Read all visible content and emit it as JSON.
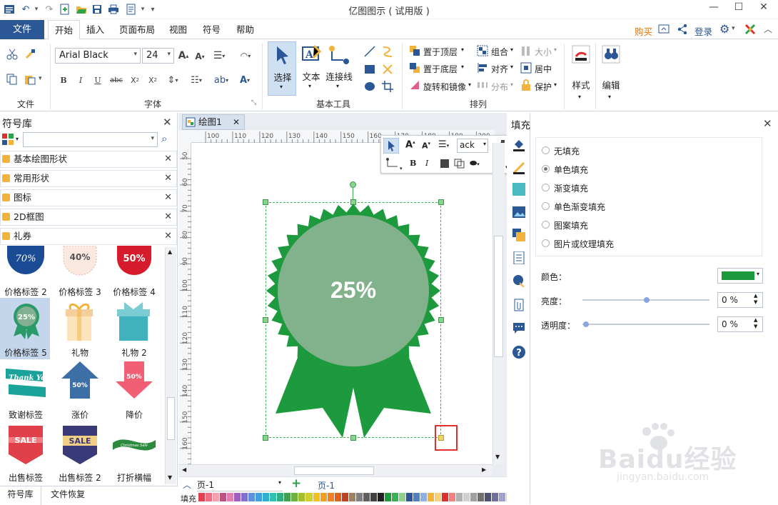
{
  "app": {
    "title": "亿图图示 ( 试用版 )",
    "buy": "购买",
    "login": "登录"
  },
  "menu": {
    "file": "文件",
    "items": [
      "开始",
      "插入",
      "页面布局",
      "视图",
      "符号",
      "帮助"
    ]
  },
  "ribbon": {
    "font_name": "Arial Black",
    "font_size": "24",
    "groups": [
      "文件",
      "字体",
      "基本工具",
      "排列"
    ],
    "tools": {
      "select": "选择",
      "text": "文本",
      "connector": "连接线"
    },
    "arrange": {
      "bring_front": "置于顶层",
      "send_back": "置于底层",
      "rotate": "旋转和镜像",
      "group": "组合",
      "align": "对齐",
      "distribute": "分布",
      "size": "大小",
      "center": "居中",
      "protect": "保护"
    },
    "style": "样式",
    "edit": "编辑"
  },
  "library": {
    "title": "符号库",
    "search_value": "",
    "categories": [
      "基本绘图形状",
      "常用形状",
      "图标",
      "2D框图",
      "礼券"
    ],
    "shapes": [
      {
        "label": "价格标签 2",
        "text": "70%"
      },
      {
        "label": "价格标签 3",
        "text": "40%"
      },
      {
        "label": "价格标签 4",
        "text": "50%"
      },
      {
        "label": "价格标签 5",
        "text": "25%"
      },
      {
        "label": "礼物",
        "text": ""
      },
      {
        "label": "礼物 2",
        "text": ""
      },
      {
        "label": "致谢标签",
        "text": "Thank You!"
      },
      {
        "label": "涨价",
        "text": "50%"
      },
      {
        "label": "降价",
        "text": "50%"
      },
      {
        "label": "出售标签",
        "text": "SALE"
      },
      {
        "label": "出售标签 2",
        "text": "SALE"
      },
      {
        "label": "打折横幅",
        "text": "Christmas Sale"
      }
    ],
    "bottom_tabs": [
      "符号库",
      "文件恢复"
    ]
  },
  "document": {
    "tab_name": "绘图1",
    "ruler_h": [
      "100",
      "110",
      "120",
      "130",
      "140",
      "150",
      "160",
      "170",
      "180",
      "190",
      "200"
    ],
    "ruler_v": [
      "50",
      "60",
      "70",
      "80",
      "90",
      "100",
      "110",
      "120",
      "130",
      "140",
      "150",
      "160"
    ],
    "badge_text": "25%",
    "float_font": "ack",
    "page_select": "页-1",
    "page_tab": "页-1",
    "fill_label": "填充"
  },
  "fill_panel": {
    "title": "填充",
    "options": [
      "无填充",
      "单色填充",
      "渐变填充",
      "单色渐变填充",
      "图案填充",
      "图片或纹理填充"
    ],
    "selected": "单色填充",
    "color_label": "颜色：",
    "color": "#1e9a3e",
    "brightness_label": "亮度：",
    "brightness_value": "0 %",
    "transparency_label": "透明度：",
    "transparency_value": "0 %"
  },
  "watermark": {
    "brand": "Baidu经验",
    "url": "jingyan.baidu.com"
  }
}
